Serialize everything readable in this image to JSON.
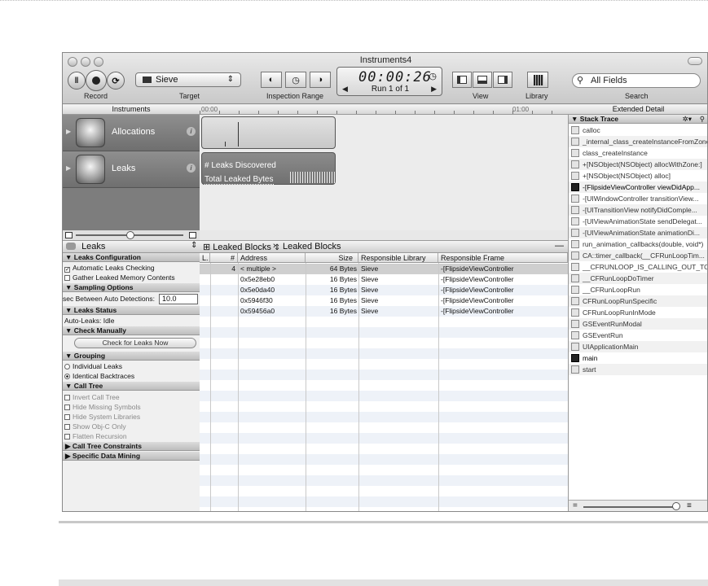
{
  "window": {
    "title": "Instruments4"
  },
  "toolbar": {
    "record_label": "Record",
    "target_label": "Target",
    "target_value": "Sieve",
    "inspection_label": "Inspection Range",
    "timer": "00:00:26",
    "run": "Run 1 of 1",
    "view_label": "View",
    "library_label": "Library",
    "search_placeholder": "All Fields",
    "search_label": "Search"
  },
  "columns": {
    "instruments": "Instruments",
    "time_start": "00:00",
    "time_mark": "01:00",
    "extended_detail": "Extended Detail"
  },
  "instruments": [
    {
      "name": "Allocations",
      "icon": "allocations-icon"
    },
    {
      "name": "Leaks",
      "icon": "leaks-icon"
    }
  ],
  "track": {
    "leaks_discovered": "# Leaks Discovered",
    "total_leaked_bytes": "Total Leaked Bytes"
  },
  "detail_bar": {
    "instrument": "Leaks",
    "view": "Leaked Blocks",
    "crumb": "Leaked Blocks"
  },
  "config": {
    "leaks_configuration": "Leaks Configuration",
    "automatic_leaks_checking": "Automatic Leaks Checking",
    "gather_leaked_memory": "Gather Leaked Memory Contents",
    "sampling_options": "Sampling Options",
    "sec_between": "sec Between Auto Detections:",
    "sec_value": "10.0",
    "leaks_status": "Leaks Status",
    "auto_leaks": "Auto-Leaks: Idle",
    "check_manually": "Check Manually",
    "check_now": "Check for Leaks Now",
    "grouping": "Grouping",
    "individual_leaks": "Individual Leaks",
    "identical_backtraces": "Identical Backtraces",
    "call_tree": "Call Tree",
    "invert_call_tree": "Invert Call Tree",
    "hide_missing_symbols": "Hide Missing Symbols",
    "hide_system_libraries": "Hide System Libraries",
    "show_objc_only": "Show Obj-C Only",
    "flatten_recursion": "Flatten Recursion",
    "call_tree_constraints": "Call Tree Constraints",
    "specific_data_mining": "Specific Data Mining"
  },
  "table": {
    "headers": [
      "L.",
      "#",
      "Address",
      "Size",
      "Responsible Library",
      "Responsible Frame"
    ],
    "rows": [
      {
        "num": "4",
        "address": "< multiple >",
        "size": "64 Bytes",
        "library": "Sieve",
        "frame": "-[FlipsideViewController"
      },
      {
        "num": "",
        "address": "0x5e28eb0",
        "size": "16 Bytes",
        "library": "Sieve",
        "frame": "-[FlipsideViewController"
      },
      {
        "num": "",
        "address": "0x5e0da40",
        "size": "16 Bytes",
        "library": "Sieve",
        "frame": "-[FlipsideViewController"
      },
      {
        "num": "",
        "address": "0x5946f30",
        "size": "16 Bytes",
        "library": "Sieve",
        "frame": "-[FlipsideViewController"
      },
      {
        "num": "",
        "address": "0x59456a0",
        "size": "16 Bytes",
        "library": "Sieve",
        "frame": "-[FlipsideViewController"
      }
    ]
  },
  "stack_trace": {
    "title": "Stack Trace",
    "frames": [
      {
        "text": "calloc",
        "icon": "library-icon"
      },
      {
        "text": "_internal_class_createInstanceFromZone",
        "icon": "library-icon"
      },
      {
        "text": "class_createInstance",
        "icon": "library-icon"
      },
      {
        "text": "+[NSObject(NSObject) allocWithZone:]",
        "icon": "framework-icon"
      },
      {
        "text": "+[NSObject(NSObject) alloc]",
        "icon": "framework-icon"
      },
      {
        "text": "-[FlipsideViewController viewDidApp...",
        "icon": "user-code-icon"
      },
      {
        "text": "-[UIWindowController transitionView...",
        "icon": "framework-icon"
      },
      {
        "text": "-[UITransitionView notifyDidComple...",
        "icon": "framework-icon"
      },
      {
        "text": "-[UIViewAnimationState sendDelegat...",
        "icon": "framework-icon"
      },
      {
        "text": "-[UIViewAnimationState animationDi...",
        "icon": "framework-icon"
      },
      {
        "text": "run_animation_callbacks(double, void*)",
        "icon": "framework-icon"
      },
      {
        "text": "CA::timer_callback(__CFRunLoopTim...",
        "icon": "framework-icon"
      },
      {
        "text": "__CFRUNLOOP_IS_CALLING_OUT_TO...",
        "icon": "framework-icon"
      },
      {
        "text": "__CFRunLoopDoTimer",
        "icon": "framework-icon"
      },
      {
        "text": "__CFRunLoopRun",
        "icon": "framework-icon"
      },
      {
        "text": "CFRunLoopRunSpecific",
        "icon": "framework-icon"
      },
      {
        "text": "CFRunLoopRunInMode",
        "icon": "framework-icon"
      },
      {
        "text": "GSEventRunModal",
        "icon": "framework-icon"
      },
      {
        "text": "GSEventRun",
        "icon": "framework-icon"
      },
      {
        "text": "UIApplicationMain",
        "icon": "framework-icon"
      },
      {
        "text": "main",
        "icon": "user-code-icon"
      },
      {
        "text": "start",
        "icon": "library-icon"
      }
    ]
  }
}
